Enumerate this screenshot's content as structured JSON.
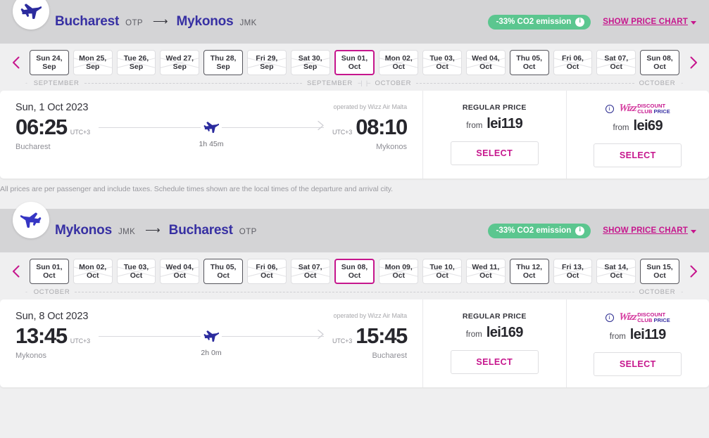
{
  "journeys": [
    {
      "id": "outbound",
      "plane_icon": "airplane-icon",
      "origin_city": "Bucharest",
      "origin_code": "OTP",
      "arrow": "⟶",
      "dest_city": "Mykonos",
      "dest_code": "JMK",
      "co2_badge": "-33% CO2 emission",
      "co2_info_icon": "i",
      "price_chart_label": "SHOW PRICE CHART",
      "prev_icon": "chevron-left-icon",
      "next_icon": "chevron-right-icon",
      "dates": [
        {
          "day": "Sun 24,",
          "month": "Sep",
          "state": "available"
        },
        {
          "day": "Mon 25,",
          "month": "Sep",
          "state": "unavailable"
        },
        {
          "day": "Tue 26,",
          "month": "Sep",
          "state": "unavailable"
        },
        {
          "day": "Wed 27,",
          "month": "Sep",
          "state": "unavailable"
        },
        {
          "day": "Thu 28,",
          "month": "Sep",
          "state": "available"
        },
        {
          "day": "Fri 29,",
          "month": "Sep",
          "state": "unavailable"
        },
        {
          "day": "Sat 30,",
          "month": "Sep",
          "state": "unavailable"
        },
        {
          "day": "Sun 01,",
          "month": "Oct",
          "state": "selected"
        },
        {
          "day": "Mon 02,",
          "month": "Oct",
          "state": "unavailable"
        },
        {
          "day": "Tue 03,",
          "month": "Oct",
          "state": "unavailable"
        },
        {
          "day": "Wed 04,",
          "month": "Oct",
          "state": "unavailable"
        },
        {
          "day": "Thu 05,",
          "month": "Oct",
          "state": "available"
        },
        {
          "day": "Fri 06,",
          "month": "Oct",
          "state": "unavailable"
        },
        {
          "day": "Sat 07,",
          "month": "Oct",
          "state": "unavailable"
        },
        {
          "day": "Sun 08,",
          "month": "Oct",
          "state": "available"
        }
      ],
      "ruler": {
        "left_tick": "-",
        "left_label": "SEPTEMBER",
        "mid_label": "SEPTEMBER",
        "mid_sep_left": "--|",
        "mid_sep_right": "|--",
        "mid_label2": "OCTOBER",
        "right_label": "OCTOBER",
        "right_tick": "-"
      },
      "flight": {
        "date": "Sun, 1 Oct 2023",
        "operated_by": "operated by Wizz Air Malta",
        "depart_time": "06:25",
        "depart_utc": "UTC+3",
        "depart_city": "Bucharest",
        "arrive_time": "08:10",
        "arrive_utc": "UTC+3",
        "arrive_city": "Mykonos",
        "duration": "1h 45m"
      },
      "regular": {
        "label": "REGULAR PRICE",
        "from": "from",
        "price": "lei119",
        "select": "SELECT"
      },
      "wdc": {
        "info_icon": "i",
        "wizz": "Wizz",
        "word_discount": "DISCOUNT",
        "word_club": "CLUB",
        "word_price": "PRICE",
        "from": "from",
        "price": "lei69",
        "select": "SELECT"
      },
      "disclaimer": "All prices are per passenger and include taxes. Schedule times shown are the local times of the departure and arrival city."
    },
    {
      "id": "return",
      "plane_icon": "airplane-return-icon",
      "origin_city": "Mykonos",
      "origin_code": "JMK",
      "arrow": "⟶",
      "dest_city": "Bucharest",
      "dest_code": "OTP",
      "co2_badge": "-33% CO2 emission",
      "co2_info_icon": "i",
      "price_chart_label": "SHOW PRICE CHART",
      "prev_icon": "chevron-left-icon",
      "next_icon": "chevron-right-icon",
      "dates": [
        {
          "day": "Sun 01,",
          "month": "Oct",
          "state": "available"
        },
        {
          "day": "Mon 02,",
          "month": "Oct",
          "state": "unavailable"
        },
        {
          "day": "Tue 03,",
          "month": "Oct",
          "state": "unavailable"
        },
        {
          "day": "Wed 04,",
          "month": "Oct",
          "state": "unavailable"
        },
        {
          "day": "Thu 05,",
          "month": "Oct",
          "state": "available"
        },
        {
          "day": "Fri 06,",
          "month": "Oct",
          "state": "unavailable"
        },
        {
          "day": "Sat 07,",
          "month": "Oct",
          "state": "unavailable"
        },
        {
          "day": "Sun 08,",
          "month": "Oct",
          "state": "selected"
        },
        {
          "day": "Mon 09,",
          "month": "Oct",
          "state": "unavailable"
        },
        {
          "day": "Tue 10,",
          "month": "Oct",
          "state": "unavailable"
        },
        {
          "day": "Wed 11,",
          "month": "Oct",
          "state": "unavailable"
        },
        {
          "day": "Thu 12,",
          "month": "Oct",
          "state": "available"
        },
        {
          "day": "Fri 13,",
          "month": "Oct",
          "state": "unavailable"
        },
        {
          "day": "Sat 14,",
          "month": "Oct",
          "state": "unavailable"
        },
        {
          "day": "Sun 15,",
          "month": "Oct",
          "state": "available"
        }
      ],
      "ruler": {
        "left_tick": "-",
        "left_label": "OCTOBER",
        "mid_label": "",
        "mid_sep_left": "",
        "mid_sep_right": "",
        "mid_label2": "",
        "right_label": "OCTOBER",
        "right_tick": "-"
      },
      "flight": {
        "date": "Sun, 8 Oct 2023",
        "operated_by": "operated by Wizz Air Malta",
        "depart_time": "13:45",
        "depart_utc": "UTC+3",
        "depart_city": "Mykonos",
        "arrive_time": "15:45",
        "arrive_utc": "UTC+3",
        "arrive_city": "Bucharest",
        "duration": "2h 0m"
      },
      "regular": {
        "label": "REGULAR PRICE",
        "from": "from",
        "price": "lei169",
        "select": "SELECT"
      },
      "wdc": {
        "info_icon": "i",
        "wizz": "Wizz",
        "word_discount": "DISCOUNT",
        "word_club": "CLUB",
        "word_price": "PRICE",
        "from": "from",
        "price": "lei119",
        "select": "SELECT"
      },
      "disclaimer": ""
    }
  ],
  "colors": {
    "accent_magenta": "#c6168d",
    "brand_navy": "#3730a3",
    "co2_green": "#5bc68f",
    "header_grey": "#d4d4d6",
    "page_bg": "#efeff0"
  }
}
